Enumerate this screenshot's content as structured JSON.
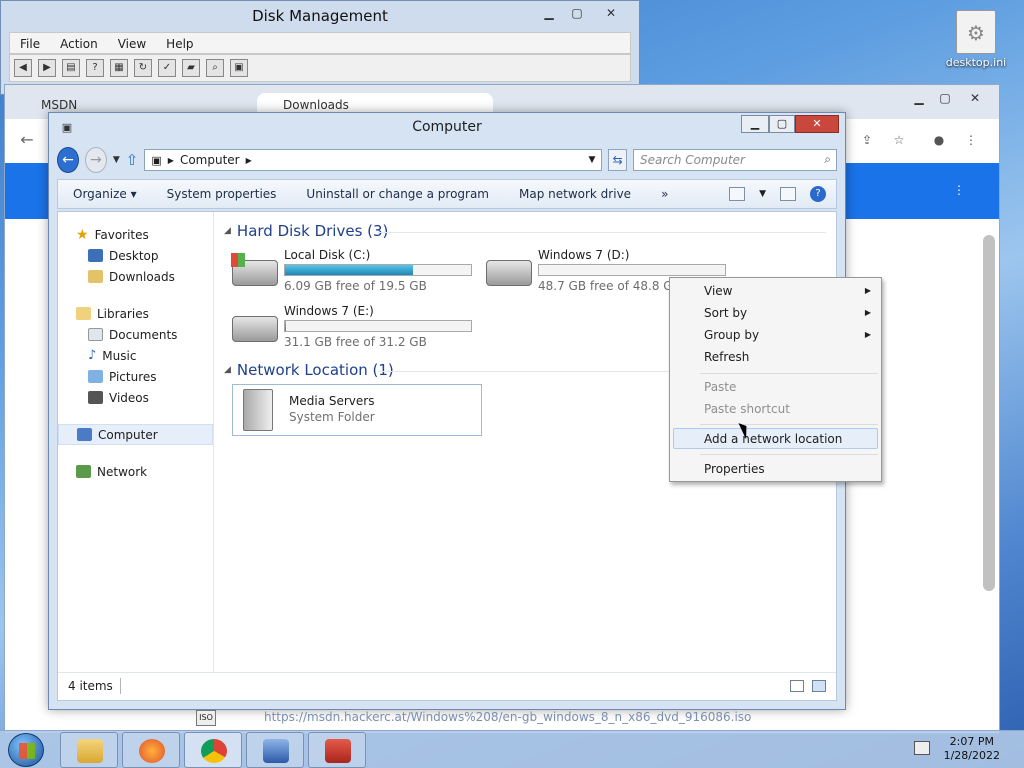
{
  "desktop": {
    "icon_label": "desktop.ini"
  },
  "disk_mgmt": {
    "title": "Disk Management",
    "menu": [
      "File",
      "Action",
      "View",
      "Help"
    ]
  },
  "browser": {
    "tabs": [
      {
        "label": "MSDN"
      },
      {
        "label": "Downloads"
      }
    ],
    "status_link": "https://msdn.hackerc.at/Windows%208/en-gb_windows_8_n_x86_dvd_916086.iso",
    "iso_label": "ISO"
  },
  "explorer": {
    "title": "Computer",
    "address": "Computer",
    "search_placeholder": "Search Computer",
    "commands": [
      "Organize ▾",
      "System properties",
      "Uninstall or change a program",
      "Map network drive",
      "»"
    ],
    "nav": {
      "favorites": {
        "label": "Favorites",
        "items": [
          "Desktop",
          "Downloads"
        ]
      },
      "libraries": {
        "label": "Libraries",
        "items": [
          "Documents",
          "Music",
          "Pictures",
          "Videos"
        ]
      },
      "computer": "Computer",
      "network": "Network"
    },
    "groups": {
      "hdd": "Hard Disk Drives (3)",
      "net": "Network Location (1)"
    },
    "drives": [
      {
        "name": "Local Disk (C:)",
        "free": "6.09 GB free of 19.5 GB",
        "used_fraction": 0.69,
        "icon": "hard-drive-windows"
      },
      {
        "name": "Windows 7 (D:)",
        "free": "48.7 GB free of 48.8 GB",
        "used_fraction": 0.002,
        "icon": "hard-drive"
      },
      {
        "name": "Windows 7 (E:)",
        "free": "31.1 GB free of 31.2 GB",
        "used_fraction": 0.003,
        "icon": "hard-drive"
      }
    ],
    "network_location": {
      "name": "Media Servers",
      "sub": "System Folder"
    },
    "status": {
      "count": "4 items"
    }
  },
  "context_menu": {
    "items": [
      {
        "label": "View",
        "submenu": true,
        "disabled": false
      },
      {
        "label": "Sort by",
        "submenu": true,
        "disabled": false
      },
      {
        "label": "Group by",
        "submenu": true,
        "disabled": false
      },
      {
        "label": "Refresh",
        "submenu": false,
        "disabled": false
      },
      {
        "label": "Paste",
        "submenu": false,
        "disabled": true
      },
      {
        "label": "Paste shortcut",
        "submenu": false,
        "disabled": true
      },
      {
        "label": "Add a network location",
        "submenu": false,
        "disabled": false
      },
      {
        "label": "Properties",
        "submenu": false,
        "disabled": false
      }
    ]
  },
  "taskbar": {
    "time": "2:07 PM",
    "date": "1/28/2022"
  }
}
